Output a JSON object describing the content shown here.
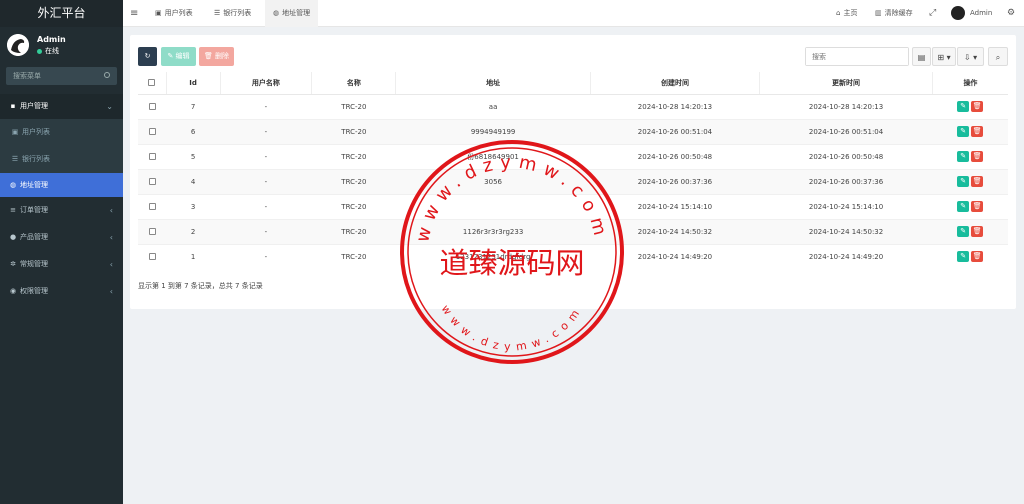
{
  "sidebar": {
    "brand": "外汇平台",
    "user": {
      "name": "Admin",
      "status": "在线"
    },
    "search_placeholder": "搜索菜单",
    "items": [
      {
        "label": "用户管理",
        "icon": "user-square-icon"
      },
      {
        "label": "用户列表",
        "icon": "id-card-icon"
      },
      {
        "label": "银行列表",
        "icon": "database-icon"
      },
      {
        "label": "地址管理",
        "icon": "globe-icon"
      },
      {
        "label": "订单管理",
        "icon": "list-icon"
      },
      {
        "label": "产品管理",
        "icon": "circle-icon"
      },
      {
        "label": "常规管理",
        "icon": "cogs-icon"
      },
      {
        "label": "权限管理",
        "icon": "users-icon"
      }
    ]
  },
  "topbar": {
    "menu_icon": "≡",
    "tabs": [
      {
        "label": "用户列表",
        "icon": "▣"
      },
      {
        "label": "银行列表",
        "icon": "☰"
      },
      {
        "label": "地址管理",
        "icon": "◍"
      }
    ],
    "home": "主页",
    "clear_cache": "清除缓存",
    "user": "Admin"
  },
  "toolbar": {
    "refresh": "↻",
    "edit": "✎ 编辑",
    "delete": "🗑 删除",
    "search_placeholder": "搜索",
    "tool_icons": [
      "▤",
      "⊞ ▾",
      "⇩ ▾",
      "⌕"
    ]
  },
  "table": {
    "headers": [
      "",
      "Id",
      "用户名称",
      "名称",
      "地址",
      "创建时间",
      "更新时间",
      "操作"
    ],
    "rows": [
      [
        "7",
        "-",
        "TRC-20",
        "aa",
        "2024-10-28 14:20:13",
        "2024-10-28 14:20:13"
      ],
      [
        "6",
        "-",
        "TRC-20",
        "9994949199",
        "2024-10-26 00:51:04",
        "2024-10-26 00:51:04"
      ],
      [
        "5",
        "-",
        "TRC-20",
        "份6818649901",
        "2024-10-26 00:50:48",
        "2024-10-26 00:50:48"
      ],
      [
        "4",
        "-",
        "TRC-20",
        "3056",
        "2024-10-26 00:37:36",
        "2024-10-26 00:37:36"
      ],
      [
        "3",
        "-",
        "TRC-20",
        "",
        "2024-10-24 15:14:10",
        "2024-10-24 15:14:10"
      ],
      [
        "2",
        "-",
        "TRC-20",
        "1126r3r3r3rg233",
        "2024-10-24 14:50:32",
        "2024-10-24 14:50:32"
      ],
      [
        "1",
        "-",
        "TRC-20",
        "1231231231drdgfdrg",
        "2024-10-24 14:49:20",
        "2024-10-24 14:49:20"
      ]
    ],
    "edit_icon": "✎",
    "delete_icon": "🗑"
  },
  "pager": "显示第 1 到第 7 条记录，总共 7 条记录",
  "watermark": {
    "center": "道臻源码网",
    "ring": "www.dzymw.com"
  },
  "colors": {
    "sidebar": "#222d32",
    "active": "#3f6fd8",
    "edit": "#18bc9c",
    "delete": "#e74c3c",
    "stamp": "#e0161a"
  }
}
